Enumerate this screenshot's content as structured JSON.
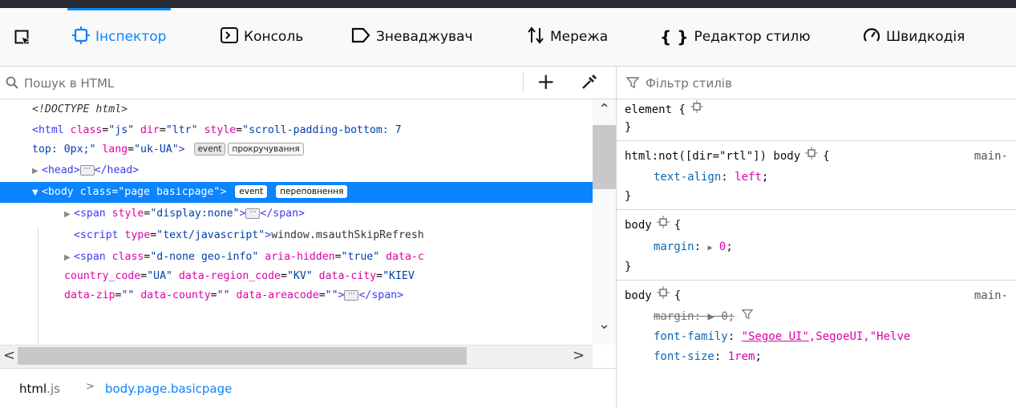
{
  "tabs": {
    "inspector": "Інспектор",
    "console": "Консоль",
    "debugger": "Зневаджувач",
    "network": "Мережа",
    "style_editor": "Редактор стилю",
    "performance": "Швидкодія"
  },
  "markup_panel": {
    "search_placeholder": "Пошук в HTML",
    "lines": {
      "doctype": "<!DOCTYPE html>",
      "html_open_a": "<html",
      "html_attr_class": "class",
      "html_attr_class_val": "\"js\"",
      "html_attr_dir": "dir",
      "html_attr_dir_val": "\"ltr\"",
      "html_attr_style": "style",
      "html_attr_style_val_a": "\"scroll-padding-bottom: 7",
      "html_attr_style_val_b": "top: 0px;\"",
      "html_attr_lang": "lang",
      "html_attr_lang_val": "\"uk-UA\"",
      "badge_event": "event",
      "badge_scroll": "прокручування",
      "head_open": "<head>",
      "head_close": "</head>",
      "body_open": "<body",
      "body_attr_class": "class",
      "body_attr_class_val": "\"page basicpage\"",
      "badge_overflow": "переповнення",
      "span1_open": "<span",
      "span1_attr_style": "style",
      "span1_attr_style_val": "\"display:none\"",
      "span_close": "</span>",
      "script_open": "<script",
      "script_attr_type": "type",
      "script_attr_type_val": "\"text/javascript\"",
      "script_text": "window.msauthSkipRefresh",
      "span2_open": "<span",
      "span2_attr_class": "class",
      "span2_attr_class_val": "\"d-none geo-info\"",
      "span2_attr_aria": "aria-hidden",
      "span2_attr_aria_val": "\"true\"",
      "span2_attr_datac": "data-c",
      "country_code": "country_code",
      "country_code_val": "\"UA\"",
      "region_code": "data-region_code",
      "region_code_val": "\"KV\"",
      "city": "data-city",
      "city_val": "\"KIEV",
      "zip": "data-zip",
      "zip_val": "\"\"",
      "county": "data-county",
      "county_val": "\"\"",
      "areacode": "data-areacode",
      "areacode_val": "\"\""
    }
  },
  "breadcrumbs": {
    "first_tag": "html",
    "first_class": ".js",
    "second": "body.page.basicpage"
  },
  "rules_panel": {
    "filter_placeholder": "Фільтр стилів",
    "element_selector": "element {",
    "close_brace": "}",
    "rule1_selector": "html:not([dir=\"rtl\"]) body",
    "rule1_source": "main-",
    "rule1_prop": "text-align",
    "rule1_val": "left",
    "rule2_selector": "body",
    "rule2_prop": "margin",
    "rule2_val": "0",
    "rule3_selector": "body",
    "rule3_source": "main-",
    "rule3_prop_margin": "margin:",
    "rule3_val_margin": "0;",
    "rule3_prop_font": "font-family",
    "rule3_val_font_ul": "\"Segoe UI\"",
    "rule3_val_font_rest": ",SegoeUI,\"Helve",
    "rule3_prop_size": "font-size",
    "rule3_val_size": "1rem"
  }
}
